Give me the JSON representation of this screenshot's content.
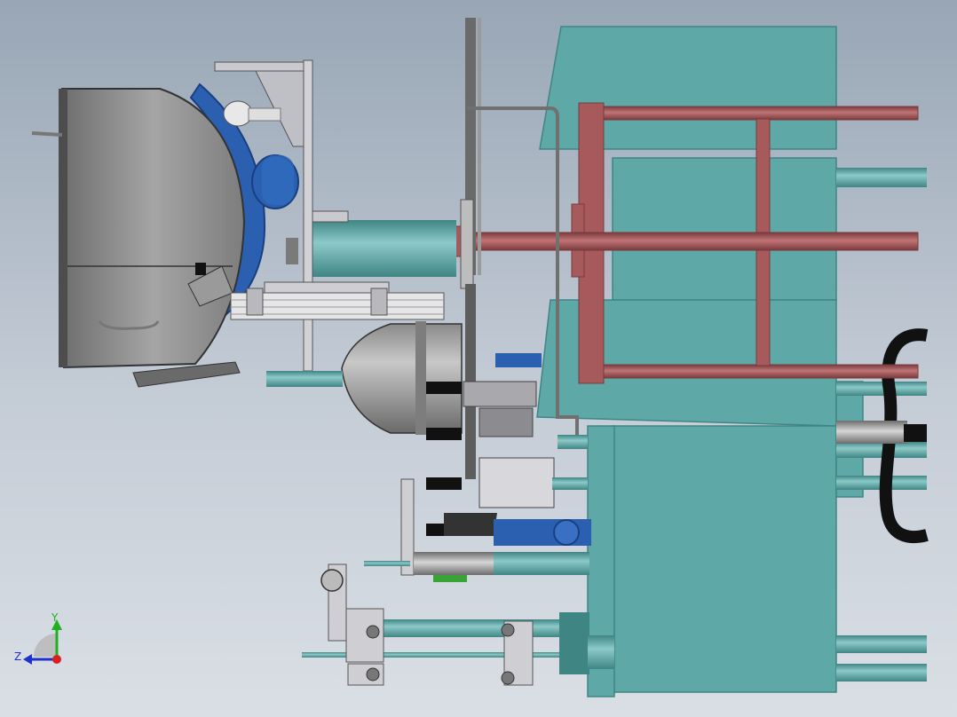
{
  "colors": {
    "teal": "#5ea9a8",
    "teal_dark": "#3f8584",
    "teal_light": "#78bdbc",
    "red": "#a65a5c",
    "red_dark": "#7a3a3c",
    "gray": "#9d9d9d",
    "gray_light": "#cfcfd3",
    "gray_dark": "#5e5e60",
    "blue": "#2b5fb0",
    "blue_dark": "#1a3f80",
    "green": "#3aa336",
    "black": "#111111",
    "axis_x": "#d92020",
    "axis_y": "#20b020",
    "axis_z": "#2030d0"
  },
  "triad": {
    "y_label": "Y",
    "z_label": "Z"
  },
  "icons": {
    "triad": "coordinate-triad-icon"
  }
}
